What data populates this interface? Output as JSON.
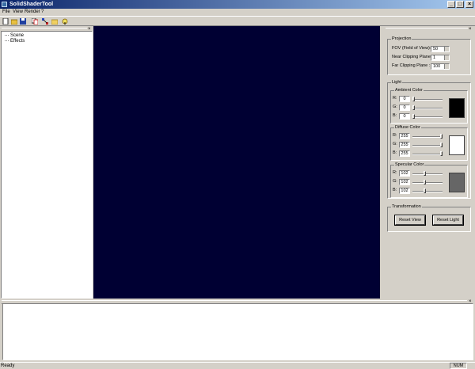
{
  "window": {
    "title": "SolidShaderTool",
    "minimize": "_",
    "maximize": "□",
    "close": "×"
  },
  "menu": {
    "file": "File",
    "view": "View",
    "render": "Render",
    "help": "?"
  },
  "toolbar": {
    "icons": [
      "new-icon",
      "open-icon",
      "save-icon",
      "copy-icon",
      "network-icon",
      "folder-icon",
      "help-icon"
    ]
  },
  "tree": {
    "items": [
      "Scene",
      "Effects"
    ],
    "close": "×"
  },
  "properties": {
    "close": "×",
    "projection": {
      "label": "Projection",
      "fov_label": "FOV (Field of View):",
      "fov_value": "50",
      "near_label": "Near Clipping Plane :",
      "near_value": "1",
      "far_label": "Far Clipping Plane :",
      "far_value": "100"
    },
    "light": {
      "label": "Light",
      "ambient": {
        "label": "Ambient Color",
        "r": "0",
        "g": "0",
        "b": "0",
        "color": "#000000",
        "r_level": 0,
        "g_level": 0,
        "b_level": 0
      },
      "diffuse": {
        "label": "Diffuse Color",
        "r": "255",
        "g": "255",
        "b": "255",
        "color": "#ffffff",
        "r_level": 255,
        "g_level": 255,
        "b_level": 255
      },
      "specular": {
        "label": "Specular Color",
        "r": "102",
        "g": "102",
        "b": "102",
        "color": "#666666",
        "r_level": 102,
        "g_level": 102,
        "b_level": 102
      },
      "channel_r": "R:",
      "channel_g": "G:",
      "channel_b": "B:"
    },
    "transformation": {
      "label": "Transformation",
      "reset_view": "Reset View",
      "reset_light": "Reset Light"
    }
  },
  "viewport": {
    "background": "#000033"
  },
  "output": {
    "close": "×"
  },
  "status": {
    "text": "Ready",
    "num": "NUM"
  }
}
